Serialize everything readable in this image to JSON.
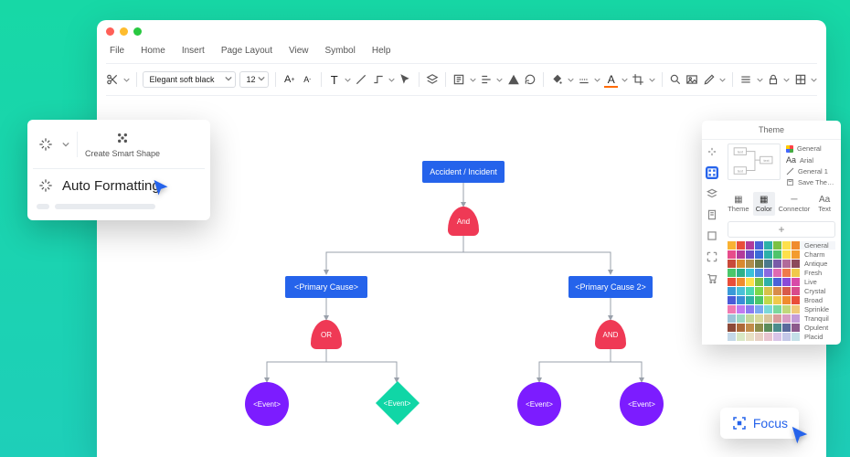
{
  "menubar": {
    "file": "File",
    "home": "Home",
    "insert": "Insert",
    "page_layout": "Page Layout",
    "view": "View",
    "symbol": "Symbol",
    "help": "Help"
  },
  "toolbar": {
    "font": "Elegant soft black",
    "size": "12"
  },
  "popup": {
    "create_smart_shape": "Create Smart Shape",
    "auto_formatting": "Auto Formatting"
  },
  "flow": {
    "root": "Accident / Incident",
    "gate_top": "And",
    "cause1": "<Primary Cause>",
    "cause2": "<Primary Cause 2>",
    "gate_left": "OR",
    "gate_right": "AND",
    "event": "<Event>"
  },
  "theme": {
    "title": "Theme",
    "side_general": "General",
    "side_font": "Arial",
    "side_general1": "General 1",
    "side_save": "Save The…",
    "tabs": {
      "theme": "Theme",
      "color": "Color",
      "connector": "Connector",
      "text": "Text"
    },
    "rows": [
      "General",
      "Charm",
      "Antique",
      "Fresh",
      "Live",
      "Crystal",
      "Broad",
      "Sprinkle",
      "Tranquil",
      "Opulent",
      "Placid"
    ]
  },
  "focus": {
    "label": "Focus"
  },
  "colors": {
    "blue": "#2563eb",
    "red": "#ef3955",
    "purple": "#7c1cff",
    "teal": "#10d6a6"
  }
}
